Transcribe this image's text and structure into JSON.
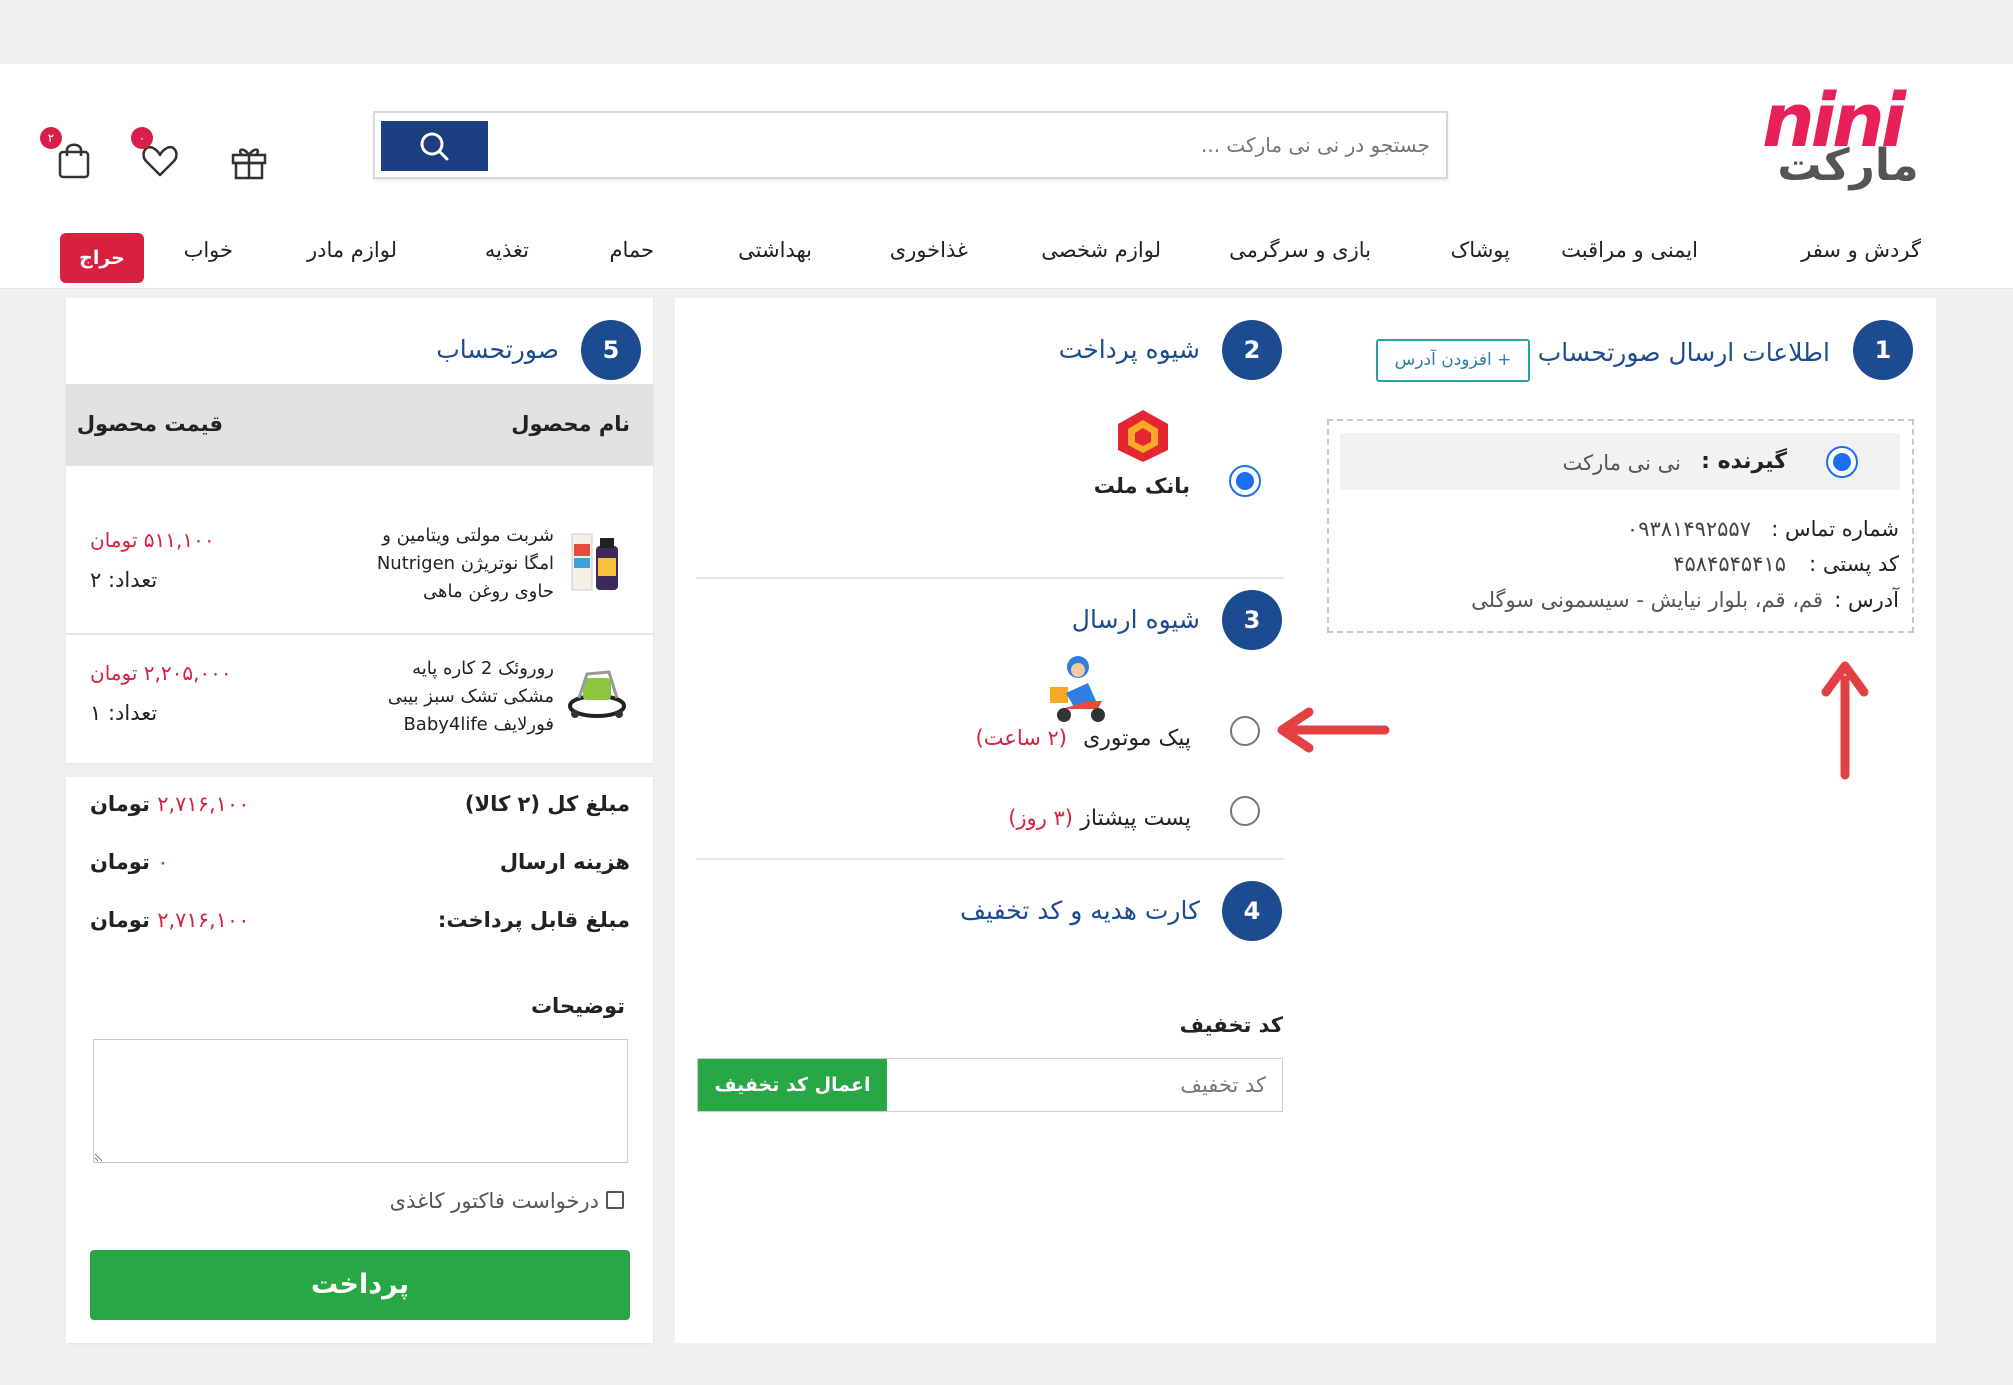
{
  "header": {
    "logo_en": "nini",
    "logo_fa": "مارکت",
    "search_placeholder": "جستجو در نی نی مارکت ...",
    "cart_count": "۲",
    "wishlist_count": "۰"
  },
  "nav": {
    "items": [
      "گردش و سفر",
      "ایمنی و مراقبت",
      "پوشاک",
      "بازی و سرگرمی",
      "لوازم شخصی",
      "غذاخوری",
      "بهداشتی",
      "حمام",
      "تغذیه",
      "لوازم مادر",
      "خواب"
    ],
    "sale": "حراج"
  },
  "address_section": {
    "step": "1",
    "title": "اطلاعات ارسال صورتحساب",
    "add_button": "+ افزودن آدرس",
    "recipient_label": "گیرنده :",
    "recipient_value": "نی نی مارکت",
    "phone_label": "شماره تماس :",
    "phone_value": "۰۹۳۸۱۴۹۲۵۵۷",
    "postal_label": "کد پستی :",
    "postal_value": "۴۵۸۴۵۴۵۴۱۵",
    "address_label": "آدرس :",
    "address_value": "قم، قم، بلوار نیایش - سیسمونی سوگلی"
  },
  "payment_section": {
    "step": "2",
    "title": "شیوه پرداخت",
    "bank_name": "بانک ملت"
  },
  "shipping_section": {
    "step": "3",
    "title": "شیوه ارسال",
    "options": [
      {
        "name": "پیک موتوری",
        "time": "(۲ ساعت)"
      },
      {
        "name": "پست پیشتاز",
        "time": "(۳ روز)"
      }
    ]
  },
  "discount_section": {
    "step": "4",
    "title": "کارت هدیه و کد تخفیف",
    "code_label": "کد تخفیف",
    "code_placeholder": "کد تخفیف",
    "apply_button": "اعمال کد تخفیف"
  },
  "invoice": {
    "step": "5",
    "title": "صورتحساب",
    "col_product": "نام محصول",
    "col_price": "قیمت محصول",
    "products": [
      {
        "name_lines": [
          "شربت مولتی ویتامین و",
          "امگا نوتریژن Nutrigen",
          "حاوی روغن ماهی"
        ],
        "price": "۵۱۱,۱۰۰ تومان",
        "qty": "تعداد: ۲"
      },
      {
        "name_lines": [
          "روروئک 2 کاره پایه",
          "مشکی تشک سبز بیبی",
          "فورلایف Baby4life"
        ],
        "price": "۲,۲۰۵,۰۰۰ تومان",
        "qty": "تعداد: ۱"
      }
    ],
    "total_label": "مبلغ کل (۲ کالا)",
    "total_amount": "۲,۷۱۶,۱۰۰",
    "shipping_label": "هزینه ارسال",
    "shipping_amount": "۰",
    "payable_label": "مبلغ قابل پرداخت:",
    "payable_amount": "۲,۷۱۶,۱۰۰",
    "currency": "تومان",
    "notes_label": "توضیحات",
    "paper_invoice_label": "درخواست فاکتور کاغذی",
    "pay_button": "پرداخت"
  },
  "colors": {
    "brand_blue": "#1d4b8f",
    "accent_red": "#d7213f",
    "pay_green": "#27a844",
    "radio_blue": "#1c6ef2"
  }
}
